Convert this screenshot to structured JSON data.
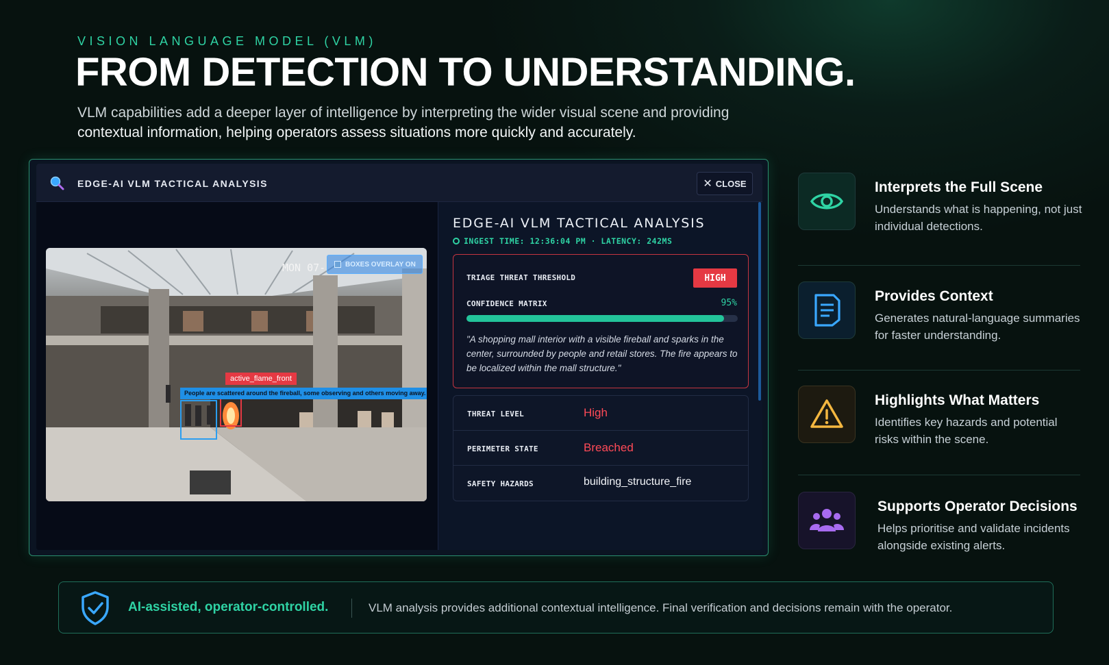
{
  "header": {
    "eyebrow": "VISION LANGUAGE MODEL (VLM)",
    "headline": "FROM DETECTION TO UNDERSTANDING.",
    "intro_line1": "VLM capabilities add a deeper layer of intelligence by interpreting the wider visual scene and providing",
    "intro_line2": "contextual information, helping operators assess situations more quickly and accurately."
  },
  "panel": {
    "title": "EDGE-AI VLM TACTICAL ANALYSIS",
    "close_label": "CLOSE",
    "camera": {
      "timestamp": "MON 07-",
      "overlay_toggle_label": "BOXES OVERLAY ON",
      "detection_label": "active_flame_front",
      "caption": "People are scattered around the fireball, some observing and others moving away."
    },
    "analysis": {
      "title": "EDGE-AI VLM TACTICAL ANALYSIS",
      "meta": "INGEST TIME: 12:36:04 PM · LATENCY: 242MS",
      "triage_label": "TRIAGE THREAT THRESHOLD",
      "triage_value": "HIGH",
      "confidence_label": "CONFIDENCE MATRIX",
      "confidence_value": "95%",
      "confidence_fraction": 0.95,
      "quote": "\"A shopping mall interior with a visible fireball and sparks in the center, surrounded by people and retail stores. The fire appears to be localized within the mall structure.\"",
      "rows": [
        {
          "label": "THREAT LEVEL",
          "value": "High"
        },
        {
          "label": "PERIMETER STATE",
          "value": "Breached"
        },
        {
          "label": "SAFETY HAZARDS",
          "value": "building_structure_fire"
        }
      ]
    }
  },
  "features": [
    {
      "title": "Interprets the Full Scene",
      "desc": "Understands what is happening, not just individual detections.",
      "icon": "eye-icon",
      "color": "#2fd3a4"
    },
    {
      "title": "Provides Context",
      "desc": "Generates natural-language summaries for faster understanding.",
      "icon": "document-icon",
      "color": "#3aa8ff"
    },
    {
      "title": "Highlights What Matters",
      "desc": "Identifies key hazards and potential risks within the scene.",
      "icon": "warning-icon",
      "color": "#f4b740"
    },
    {
      "title": "Supports Operator Decisions",
      "desc": "Helps prioritise and validate incidents alongside existing alerts.",
      "icon": "users-icon",
      "color": "#a86bf0"
    }
  ],
  "footer": {
    "strong": "AI-assisted, operator-controlled.",
    "text": "VLM analysis provides additional contextual intelligence. Final verification and decisions remain with the operator."
  },
  "colors": {
    "accent": "#2fd3a4",
    "alert": "#e53943",
    "info": "#1f8fe6"
  }
}
